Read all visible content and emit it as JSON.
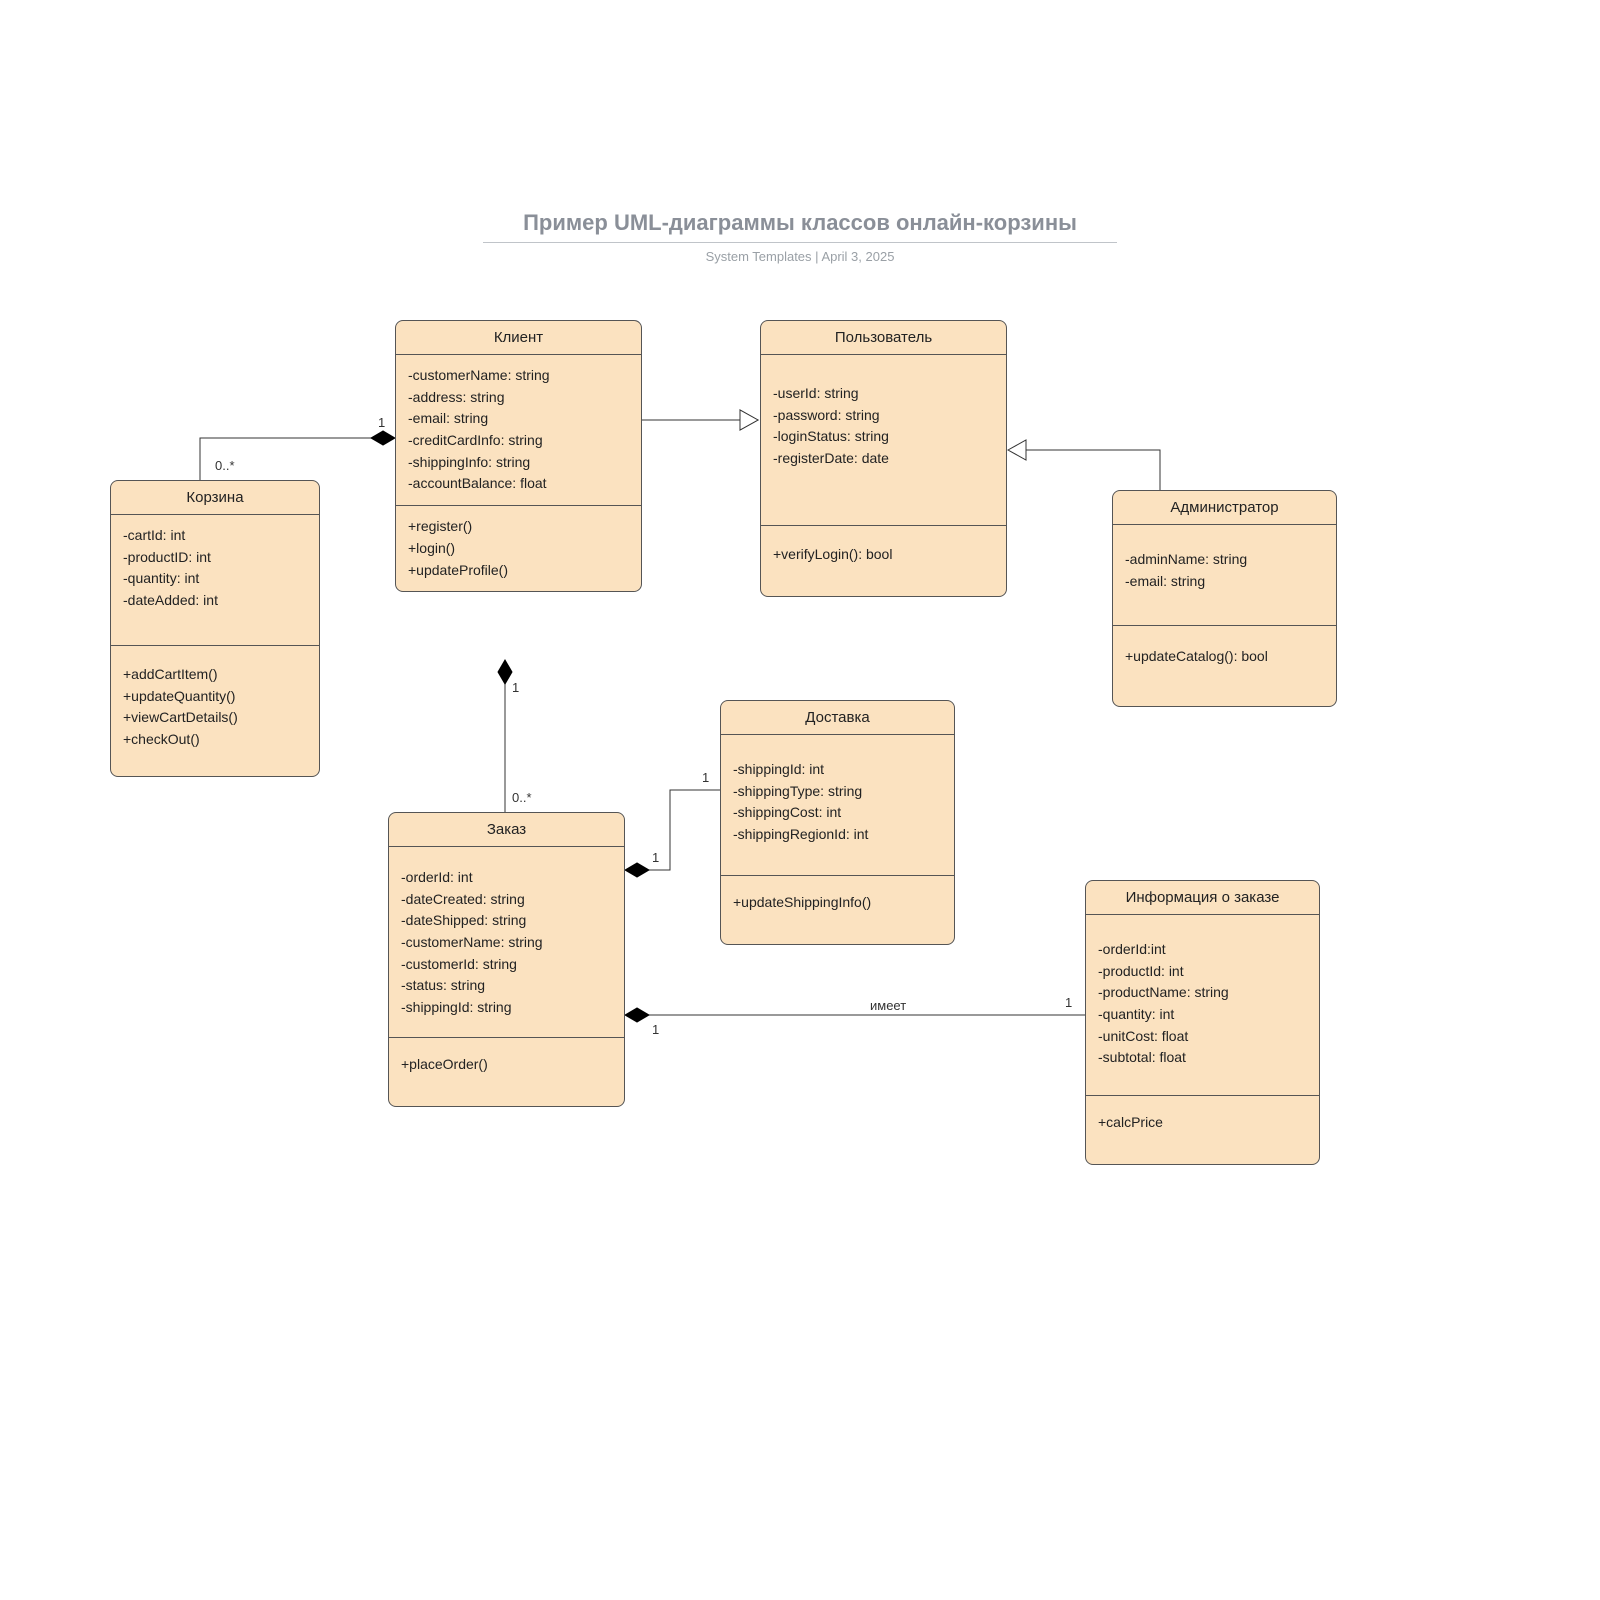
{
  "header": {
    "title": "Пример UML-диаграммы классов онлайн-корзины",
    "subtitle_left": "System Templates",
    "subtitle_sep": "  |  ",
    "subtitle_right": "April 3, 2025"
  },
  "classes": {
    "customer": {
      "name": "Клиент",
      "attrs": [
        "-customerName: string",
        "-address: string",
        "-email: string",
        "-creditCardInfo: string",
        "-shippingInfo: string",
        "-accountBalance: float"
      ],
      "ops": [
        "+register()",
        "+login()",
        "+updateProfile()"
      ]
    },
    "user": {
      "name": "Пользователь",
      "attrs": [
        "-userId: string",
        "-password: string",
        "-loginStatus: string",
        "-registerDate: date"
      ],
      "ops": [
        "+verifyLogin(): bool"
      ]
    },
    "admin": {
      "name": "Администратор",
      "attrs": [
        "-adminName: string",
        "-email: string"
      ],
      "ops": [
        "+updateCatalog(): bool"
      ]
    },
    "cart": {
      "name": "Корзина",
      "attrs": [
        "-cartId: int",
        "-productID: int",
        "-quantity: int",
        "-dateAdded: int"
      ],
      "ops": [
        "+addCartItem()",
        "+updateQuantity()",
        "+viewCartDetails()",
        "+checkOut()"
      ]
    },
    "order": {
      "name": "Заказ",
      "attrs": [
        "-orderId: int",
        "-dateCreated: string",
        "-dateShipped: string",
        "-customerName: string",
        "-customerId: string",
        "-status: string",
        "-shippingId: string"
      ],
      "ops": [
        "+placeOrder()"
      ]
    },
    "shipping": {
      "name": "Доставка",
      "attrs": [
        "-shippingId: int",
        "-shippingType: string",
        "-shippingCost: int",
        "-shippingRegionId: int"
      ],
      "ops": [
        "+updateShippingInfo()"
      ]
    },
    "orderinfo": {
      "name": "Информация о заказе",
      "attrs": [
        "-orderId:int",
        "-productId: int",
        "-productName: string",
        "-quantity: int",
        "-unitCost: float",
        "-subtotal: float"
      ],
      "ops": [
        "+calcPrice"
      ]
    }
  },
  "labels": {
    "cust_cart_1": "1",
    "cust_cart_many": "0..*",
    "cust_order_1": "1",
    "cust_order_many": "0..*",
    "order_ship_a": "1",
    "order_ship_b": "1",
    "order_info_a": "1",
    "order_info_b": "1",
    "has": "имеет"
  }
}
